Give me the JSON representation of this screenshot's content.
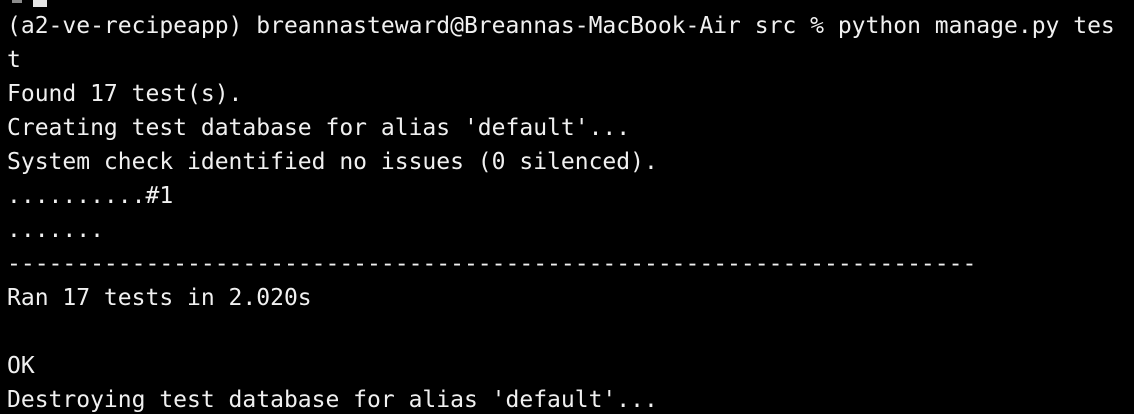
{
  "terminal": {
    "lines": [
      "(a2-ve-recipeapp) breannasteward@Breannas-MacBook-Air src % python manage.py tes",
      "t",
      "Found 17 test(s).",
      "Creating test database for alias 'default'...",
      "System check identified no issues (0 silenced).",
      "..........#1",
      ".......",
      "----------------------------------------------------------------------",
      "Ran 17 tests in 2.020s",
      "",
      "OK",
      "Destroying test database for alias 'default'..."
    ]
  },
  "colors": {
    "background": "#000000",
    "text": "#f0f0f0"
  }
}
